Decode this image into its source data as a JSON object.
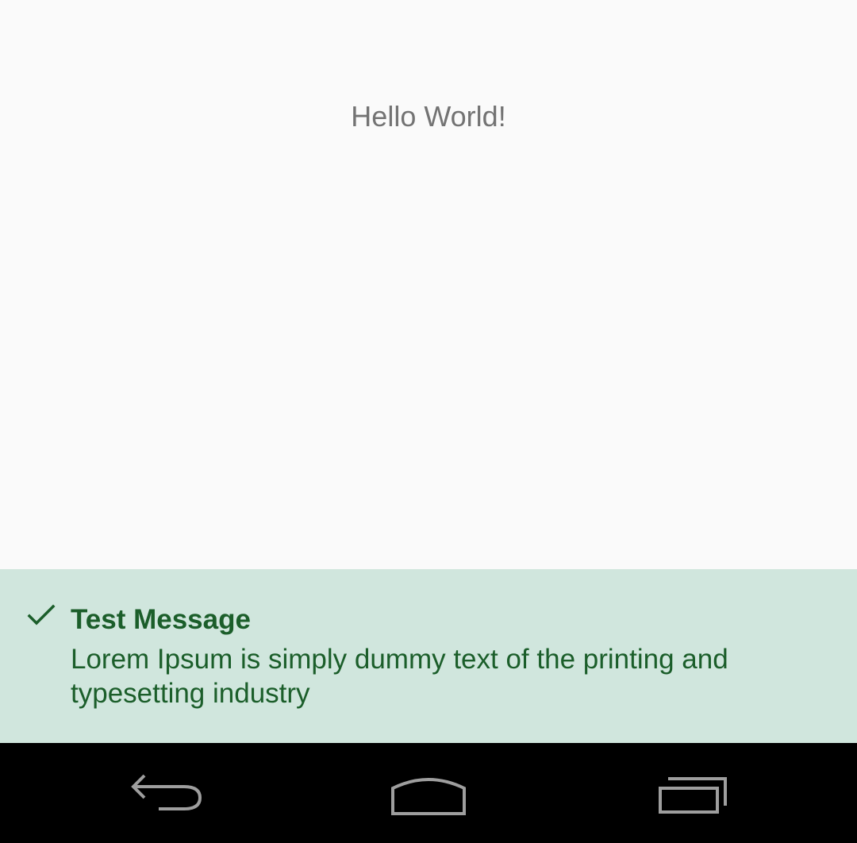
{
  "screen": {
    "hello_text": "Hello World!"
  },
  "alert": {
    "icon": "check-icon",
    "title": "Test Message",
    "body": "Lorem Ipsum is simply dummy text of the printing and typesetting industry",
    "background_color": "#d0e6dd",
    "text_color": "#1b5e2a"
  },
  "navbar": {
    "buttons": [
      {
        "icon": "back-icon"
      },
      {
        "icon": "home-icon"
      },
      {
        "icon": "recent-apps-icon"
      }
    ],
    "icon_color": "#9e9e9e"
  }
}
